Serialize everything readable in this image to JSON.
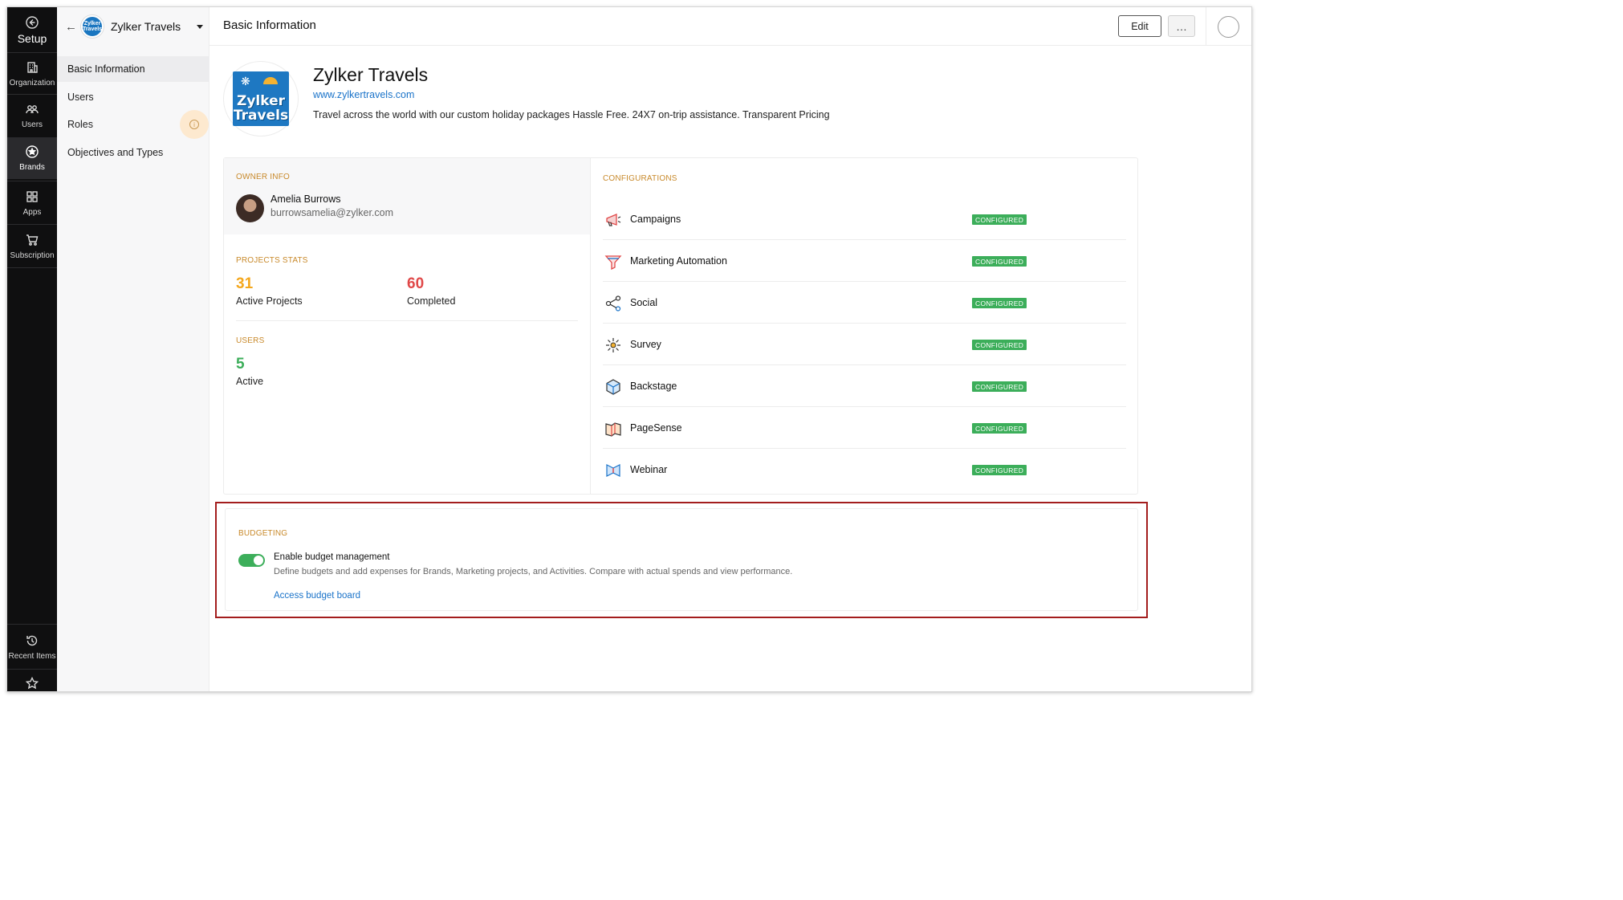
{
  "rail": {
    "setup_label": "Setup",
    "items": [
      {
        "label": "Organization",
        "icon": "building-icon"
      },
      {
        "label": "Users",
        "icon": "users-icon"
      },
      {
        "label": "Brands",
        "icon": "star-badge-icon",
        "active": true
      },
      {
        "label": "Apps",
        "icon": "grid-icon"
      },
      {
        "label": "Subscription",
        "icon": "cart-icon"
      }
    ],
    "recent_label": "Recent Items"
  },
  "sidebar": {
    "brand_title": "Zylker Travels",
    "items": [
      {
        "label": "Basic Information",
        "active": true
      },
      {
        "label": "Users"
      },
      {
        "label": "Roles"
      },
      {
        "label": "Objectives and Types"
      }
    ]
  },
  "topbar": {
    "title": "Basic Information",
    "edit_label": "Edit",
    "more_label": "…"
  },
  "brand": {
    "logo_line1": "Zylker",
    "logo_line2": "Travels",
    "name": "Zylker Travels",
    "url": "www.zylkertravels.com",
    "description": "Travel across the world with our custom holiday packages Hassle Free. 24X7 on-trip assistance. Transparent Pricing"
  },
  "owner": {
    "section": "OWNER INFO",
    "name": "Amelia Burrows",
    "email": "burrowsamelia@zylker.com"
  },
  "project_stats": {
    "section": "PROJECTS STATS",
    "active_value": "31",
    "active_label": "Active Projects",
    "completed_value": "60",
    "completed_label": "Completed"
  },
  "users_stats": {
    "section": "USERS",
    "value": "5",
    "label": "Active"
  },
  "configurations": {
    "section": "CONFIGURATIONS",
    "badge": "CONFIGURED",
    "items": [
      {
        "name": "Campaigns"
      },
      {
        "name": "Marketing Automation"
      },
      {
        "name": "Social"
      },
      {
        "name": "Survey"
      },
      {
        "name": "Backstage"
      },
      {
        "name": "PageSense"
      },
      {
        "name": "Webinar"
      }
    ]
  },
  "budgeting": {
    "section": "BUDGETING",
    "toggle_label": "Enable budget management",
    "description": "Define budgets and add expenses for Brands, Marketing projects, and Activities. Compare with actual spends and view performance.",
    "link": "Access budget board",
    "enabled": true
  },
  "colors": {
    "accent": "#1a73c9",
    "section_label": "#c8892a",
    "active_projects": "#f4a71c",
    "completed": "#e04848",
    "users_active": "#3cae5a",
    "badge": "#3cae5a",
    "highlight": "#a31d1d"
  }
}
